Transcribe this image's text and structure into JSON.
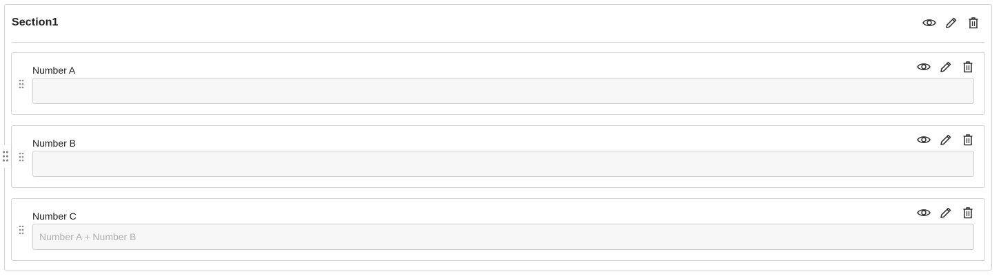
{
  "section": {
    "title": "Section1",
    "icons": [
      "eye-icon",
      "pencil-icon",
      "trash-icon"
    ]
  },
  "fields": [
    {
      "label": "Number A",
      "value": "",
      "placeholder": ""
    },
    {
      "label": "Number B",
      "value": "",
      "placeholder": ""
    },
    {
      "label": "Number C",
      "value": "",
      "placeholder": "Number A + Number B"
    }
  ],
  "colors": {
    "border": "#d4d4d4",
    "input_bg": "#f7f7f7",
    "icon": "#2b2b2b",
    "placeholder": "#b0b0b0"
  }
}
